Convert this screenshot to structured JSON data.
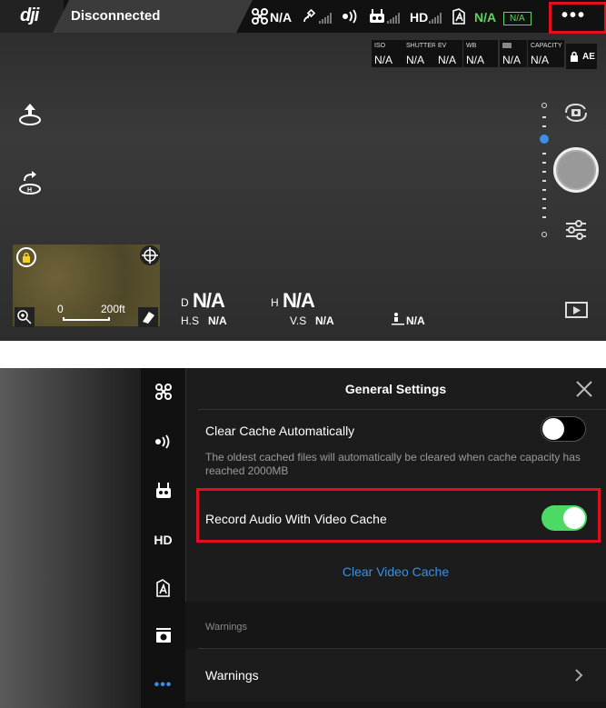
{
  "status_bar": {
    "logo": "dji",
    "connection": "Disconnected",
    "aircraft_signal": "N/A",
    "battery": "N/A",
    "battery_box": "N/A",
    "hd_label": "HD",
    "more_label": "•••"
  },
  "camera_settings": [
    {
      "label": "ISO",
      "value": "N/A"
    },
    {
      "label": "SHUTTER",
      "value": "N/A"
    },
    {
      "label": "EV",
      "value": "N/A"
    },
    {
      "label": "WB",
      "value": "N/A"
    },
    {
      "label": "",
      "value": "N/A"
    },
    {
      "label": "CAPACITY",
      "value": "N/A"
    }
  ],
  "ae_label": "AE",
  "map": {
    "scale_start": "0",
    "scale_end": "200ft"
  },
  "telemetry": {
    "d_label": "D",
    "d_value": "N/A",
    "h_label": "H",
    "h_value": "N/A",
    "hs_label": "H.S",
    "hs_value": "N/A",
    "vs_label": "V.S",
    "vs_value": "N/A",
    "dist_value": "N/A"
  },
  "sidebar": {
    "hd_label": "HD",
    "more_label": "•••"
  },
  "settings": {
    "title": "General Settings",
    "clear_cache_auto_label": "Clear Cache Automatically",
    "clear_cache_auto_on": false,
    "clear_cache_description": "The oldest cached files will automatically be cleared when cache capacity has reached 2000MB",
    "record_audio_label": "Record Audio With Video Cache",
    "record_audio_on": true,
    "clear_video_cache_label": "Clear Video Cache",
    "warnings_section": "Warnings",
    "warnings_item": "Warnings"
  },
  "colors": {
    "accent_green": "#5fd35f",
    "highlight_red": "#e0101e",
    "link_blue": "#3a8fe8",
    "toggle_on": "#4cd964"
  }
}
